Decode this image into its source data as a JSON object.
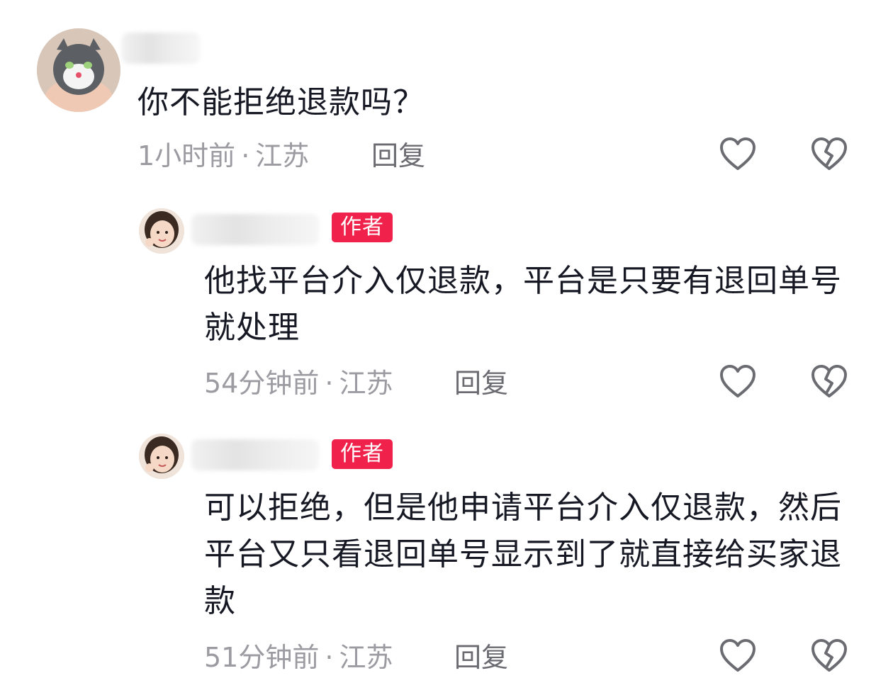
{
  "comments": [
    {
      "text": "你不能拒绝退款吗？",
      "time": "1小时前",
      "separator": "·",
      "location": "江苏",
      "reply_label": "回复"
    },
    {
      "badge": "作者",
      "text": "他找平台介入仅退款，平台是只要有退回单号就处理",
      "time": "54分钟前",
      "separator": "·",
      "location": "江苏",
      "reply_label": "回复"
    },
    {
      "badge": "作者",
      "text": "可以拒绝，但是他申请平台介入仅退款，然后平台又只看退回单号显示到了就直接给买家退款",
      "time": "51分钟前",
      "separator": "·",
      "location": "江苏",
      "reply_label": "回复"
    }
  ],
  "icons": {
    "like": "heart-outline-icon",
    "dislike": "broken-heart-icon"
  },
  "colors": {
    "badge": "#f0224b",
    "meta": "#9b9ba1",
    "text": "#161823"
  }
}
